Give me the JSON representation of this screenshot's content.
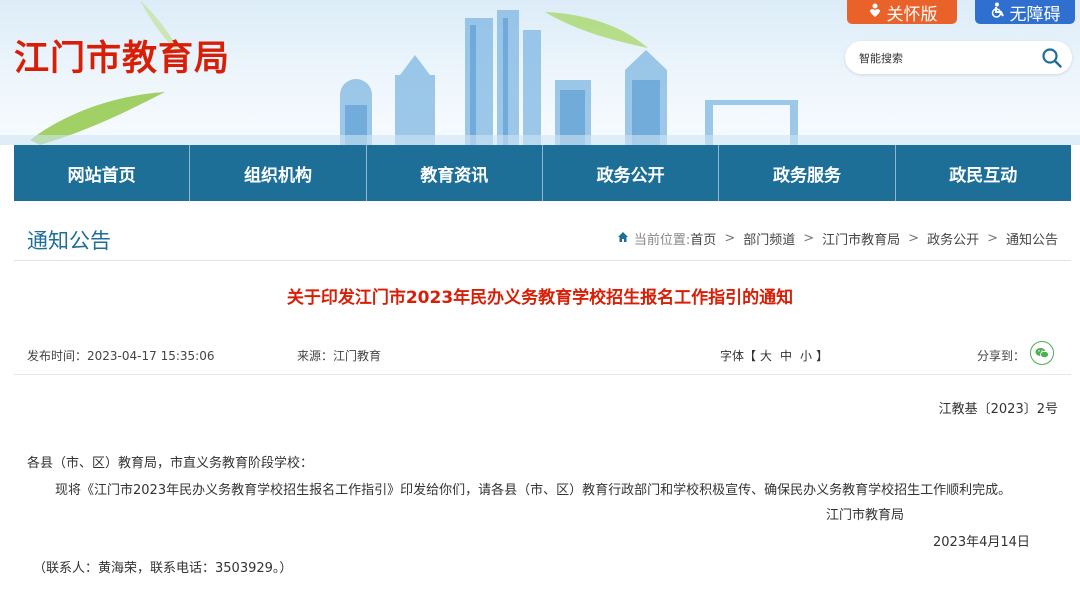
{
  "header": {
    "site_title": "江门市教育局",
    "care_button": "关怀版",
    "accessibility_button": "无障碍",
    "search_placeholder": "智能搜索"
  },
  "nav": {
    "items": [
      "网站首页",
      "组织机构",
      "教育资讯",
      "政务公开",
      "政务服务",
      "政民互动"
    ]
  },
  "section": {
    "title": "通知公告"
  },
  "breadcrumb": {
    "prefix": "当前位置:",
    "items": [
      "首页",
      "部门频道",
      "江门市教育局",
      "政务公开",
      "通知公告"
    ],
    "separator": ">"
  },
  "article": {
    "title": "关于印发江门市2023年民办义务教育学校招生报名工作指引的通知",
    "publish_label": "发布时间：",
    "publish_time": "2023-04-17 15:35:06",
    "source_label": "来源：",
    "source": "江门教育",
    "font_label": "字体【",
    "font_large": "大",
    "font_medium": "中",
    "font_small": "小",
    "font_close": "】",
    "share_label": "分享到：",
    "doc_number": "江教基〔2023〕2号",
    "recipient": "各县（市、区）教育局，市直义务教育阶段学校：",
    "body": "现将《江门市2023年民办义务教育学校招生报名工作指引》印发给你们，请各县（市、区）教育行政部门和学校积极宣传、确保民办义务教育学校招生工作顺利完成。",
    "signature": "江门市教育局",
    "date": "2023年4月14日",
    "contact": "（联系人：黄海荣，联系电话：3503929。）"
  },
  "colors": {
    "brand_red": "#d81e06",
    "nav_blue": "#1d6f98",
    "care_orange": "#e8622a",
    "access_blue": "#2f6fcf"
  },
  "icons": {
    "care": "heart-person-icon",
    "accessibility": "wheelchair-icon",
    "search": "search-icon",
    "home": "home-icon",
    "share": "wechat-icon"
  }
}
